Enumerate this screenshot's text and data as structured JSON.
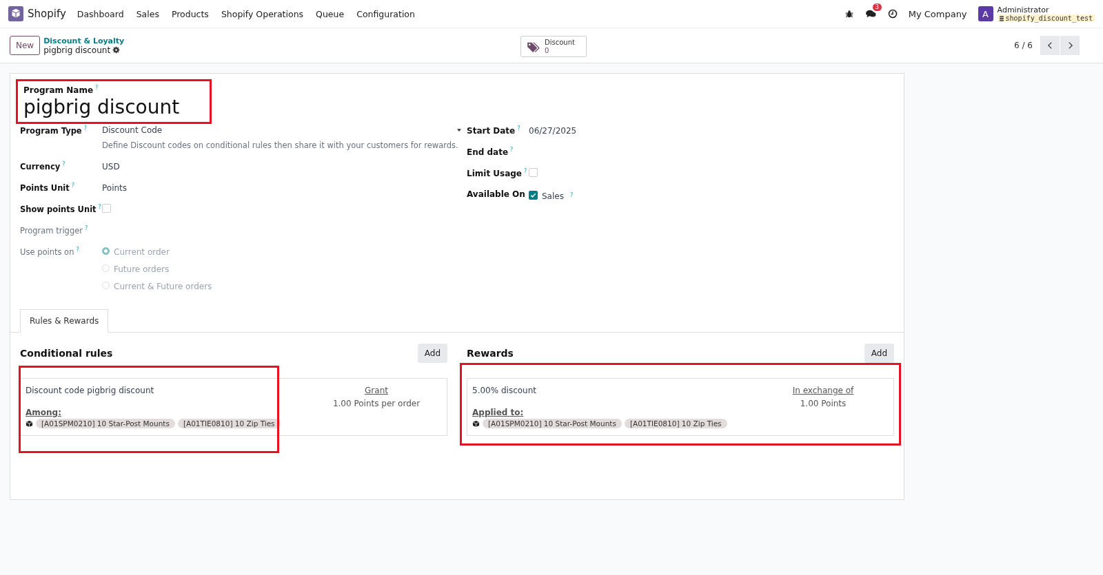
{
  "navbar": {
    "app": "Shopify",
    "menu": [
      "Dashboard",
      "Sales",
      "Products",
      "Shopify Operations",
      "Queue",
      "Configuration"
    ],
    "message_count": "3",
    "company": "My Company",
    "user_initial": "A",
    "user": "Administrator",
    "database": "shopify_discount_test"
  },
  "control_panel": {
    "new_button": "New",
    "breadcrumb": "Discount & Loyalty",
    "record": "pigbrig discount",
    "smart_button": {
      "label": "Discount",
      "value": "0"
    },
    "pager": "6 / 6"
  },
  "form": {
    "name_label": "Program Name",
    "name_help": "?",
    "name": "pigbrig discount",
    "name_highlighted": true,
    "left_fields": [
      {
        "kind": "select",
        "label": "Program Type",
        "help": "?",
        "value": "Discount Code",
        "note": "Define Discount codes on conditional rules then share it with your customers for rewards."
      },
      {
        "kind": "text",
        "label": "Currency",
        "help": "?",
        "value": "USD"
      },
      {
        "kind": "text",
        "label": "Points Unit",
        "help": "?",
        "value": "Points"
      },
      {
        "kind": "checkbox",
        "label": "Show points Unit",
        "help": "?",
        "checked": false
      },
      {
        "kind": "empty",
        "label": "Program trigger",
        "help": "?",
        "muted": true
      },
      {
        "kind": "radio",
        "label": "Use points on",
        "help": "?",
        "muted": true,
        "options": [
          {
            "label": "Current order",
            "selected": true
          },
          {
            "label": "Future orders",
            "selected": false
          },
          {
            "label": "Current & Future orders",
            "selected": false
          }
        ]
      }
    ],
    "right_fields": [
      {
        "kind": "text",
        "label": "Start Date",
        "help": "?",
        "value": "06/27/2025"
      },
      {
        "kind": "empty",
        "label": "End date",
        "help": "?"
      },
      {
        "kind": "checkbox",
        "label": "Limit Usage",
        "help": "?",
        "checked": false
      },
      {
        "kind": "checkbox",
        "label": "Available On",
        "checked": true,
        "option": "Sales",
        "option_help": "?"
      }
    ],
    "tabs": [
      {
        "label": "Rules & Rewards",
        "selected": true
      }
    ],
    "sections": [
      {
        "kind": "rules",
        "title": "Conditional rules",
        "add": "Add",
        "cards": [
          {
            "title": "Discount code pigbrig discount",
            "products_label": "Among:",
            "products": [
              "[A01SPM0210] 10 Star-Post Mounts",
              "[A01TIE0810] 10 Zip Ties"
            ],
            "right_label": "Grant",
            "right_value": "1.00 Points per order",
            "highlighted": true
          }
        ]
      },
      {
        "kind": "rewards",
        "title": "Rewards",
        "add": "Add",
        "cards": [
          {
            "title": "5.00% discount",
            "products_label": "Applied to:",
            "products": [
              "[A01SPM0210] 10 Star-Post Mounts",
              "[A01TIE0810] 10 Zip Ties"
            ],
            "right_label": "In exchange of",
            "right_value": "1.00 Points",
            "highlighted": true
          }
        ]
      }
    ]
  }
}
